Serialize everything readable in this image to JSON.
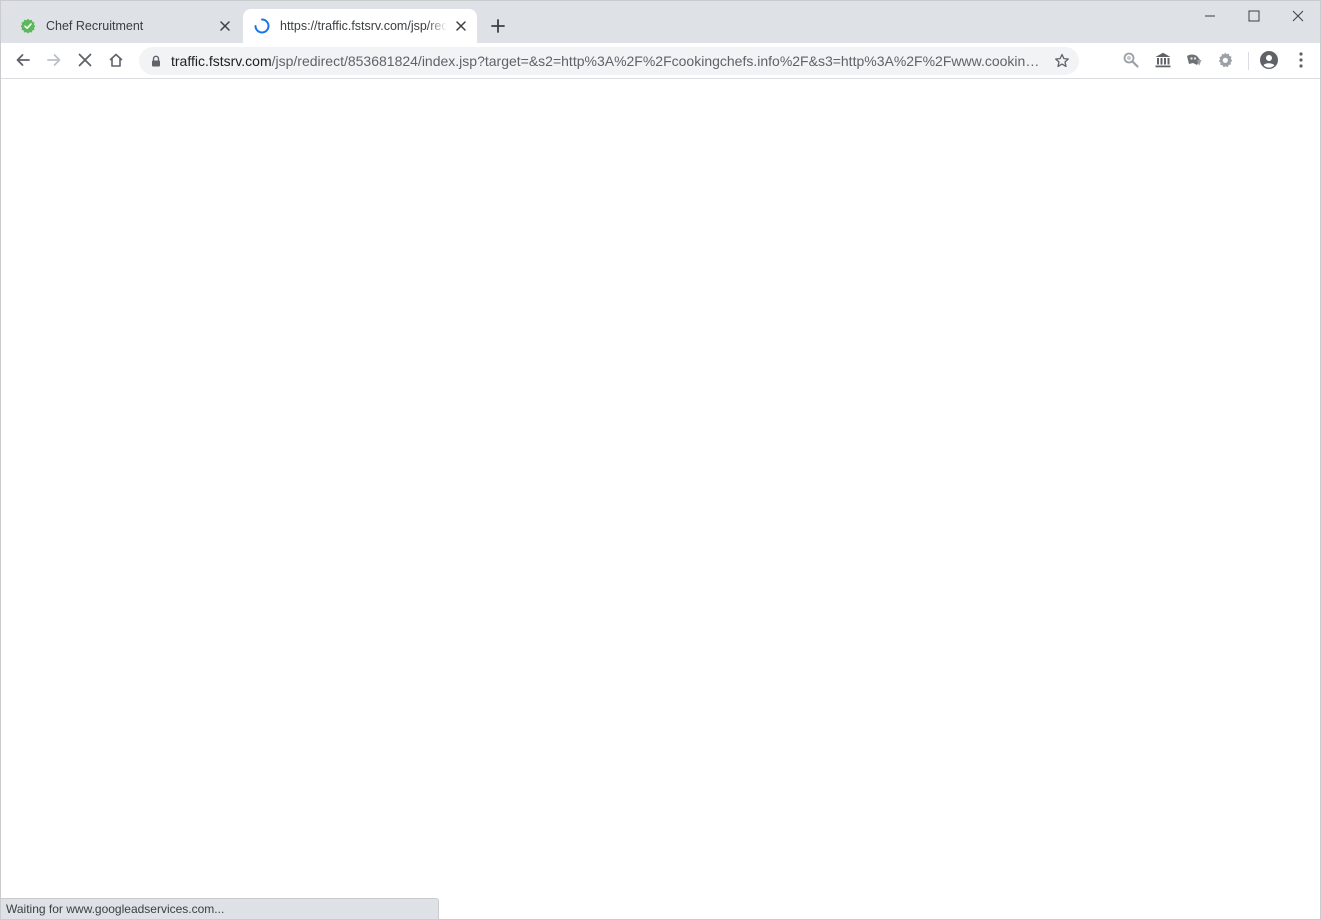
{
  "tabs": [
    {
      "title": "Chef Recruitment",
      "favicon": "green-badge-icon",
      "active": false
    },
    {
      "title": "https://traffic.fstsrv.com/jsp/redirect/853681824/index.jsp?target=&s2=http%3A%2F%2Fcookingchefs.info%2F",
      "favicon": "loading-spinner-icon",
      "active": true
    }
  ],
  "omnibox": {
    "host": "traffic.fstsrv.com",
    "path": "/jsp/redirect/853681824/index.jsp?target=&s2=http%3A%2F%2Fcookingchefs.info%2F&s3=http%3A%2F%2Fwww.cookingche..."
  },
  "status": {
    "text": "Waiting for www.googleadservices.com..."
  },
  "colors": {
    "tabstrip": "#dee1e6",
    "omnibox_bg": "#f1f3f4",
    "icon": "#5f6368",
    "spinner": "#1a73e8",
    "favicon_green": "#5cb85c"
  }
}
